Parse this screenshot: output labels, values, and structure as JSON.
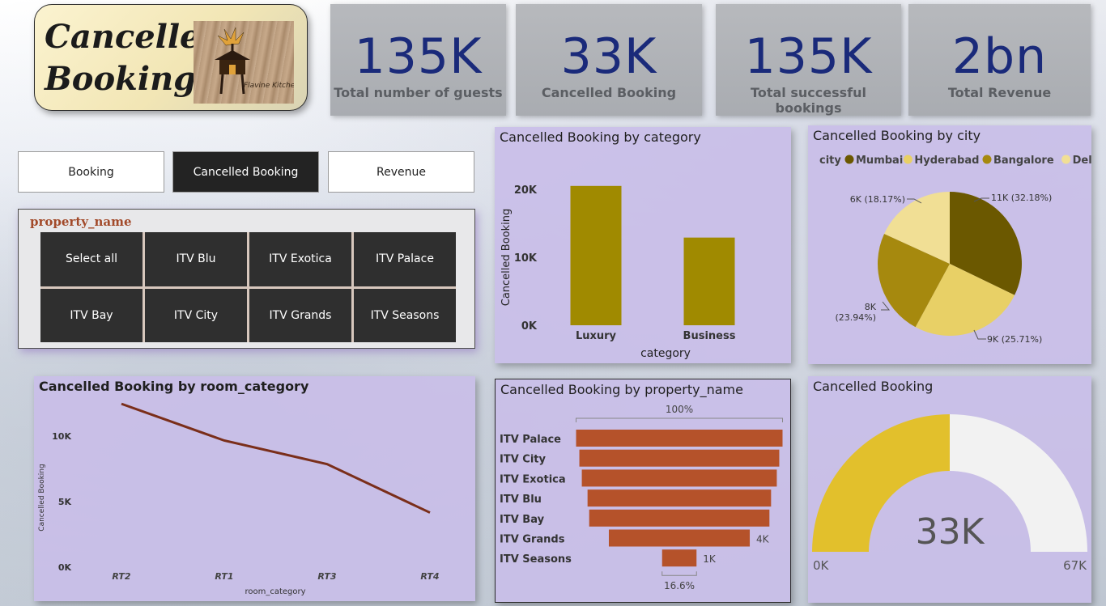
{
  "header": {
    "title_line1": "Cancelled",
    "title_line2": "Booking",
    "logo_text": "Flavine Kitchen"
  },
  "kpis": [
    {
      "value": "135K",
      "label": "Total number of guests"
    },
    {
      "value": "33K",
      "label": "Cancelled Booking"
    },
    {
      "value": "135K",
      "label": "Total successful bookings"
    },
    {
      "value": "2bn",
      "label": "Total Revenue"
    }
  ],
  "nav": {
    "booking": "Booking",
    "cancelled": "Cancelled Booking",
    "revenue": "Revenue"
  },
  "slicer": {
    "title": "property_name",
    "items": [
      "Select all",
      "ITV Blu",
      "ITV Exotica",
      "ITV Palace",
      "ITV Bay",
      "ITV City",
      "ITV Grands",
      "ITV Seasons"
    ]
  },
  "colors": {
    "kpi_value": "#1a2a7a",
    "bar_category": "#a08a00",
    "line": "#7a2e1a",
    "funnel": "#b5522a",
    "gauge_fill": "#e2c02c",
    "gauge_rest": "#f2f2f2",
    "panel_bg": "#c9bee8"
  },
  "chart_data": [
    {
      "type": "bar",
      "title": "Cancelled Booking by category",
      "xlabel": "category",
      "ylabel": "Cancelled Booking",
      "categories": [
        "Luxury",
        "Business"
      ],
      "values": [
        20500,
        12900
      ],
      "yticks": [
        "0K",
        "10K",
        "20K"
      ],
      "ylim": [
        0,
        20000
      ],
      "grid": false
    },
    {
      "type": "pie",
      "title": "Cancelled Booking by city",
      "legend_title": "city",
      "legend_position": "top",
      "slices": [
        {
          "name": "Mumbai",
          "value": 32.18,
          "label": "11K (32.18%)",
          "color": "#6b5800"
        },
        {
          "name": "Hyderabad",
          "value": 25.71,
          "label": "9K (25.71%)",
          "color": "#e8d066"
        },
        {
          "name": "Bangalore",
          "value": 23.94,
          "label_line1": "8K",
          "label_line2": "(23.94%)",
          "color": "#a6890e"
        },
        {
          "name": "Delhi",
          "value": 18.17,
          "label": "6K (18.17%)",
          "color": "#f1df95"
        }
      ]
    },
    {
      "type": "line",
      "title": "Cancelled Booking by room_category",
      "xlabel": "room_category",
      "ylabel": "Cancelled Booking",
      "categories": [
        "RT2",
        "RT1",
        "RT3",
        "RT4"
      ],
      "values": [
        12400,
        9600,
        7800,
        4100
      ],
      "yticks": [
        "0K",
        "5K",
        "10K"
      ],
      "ylim": [
        0,
        12000
      ]
    },
    {
      "type": "funnel",
      "title": "Cancelled Booking by property_name",
      "top_label": "100%",
      "bottom_label": "16.6%",
      "categories": [
        "ITV Palace",
        "ITV City",
        "ITV Exotica",
        "ITV Blu",
        "ITV Bay",
        "ITV Grands",
        "ITV Seasons"
      ],
      "values": [
        6300,
        6100,
        5950,
        5600,
        5500,
        4300,
        1050
      ],
      "data_labels": [
        "",
        "",
        "",
        "",
        "",
        "4K",
        "1K"
      ]
    },
    {
      "type": "gauge",
      "title": "Cancelled Booking",
      "value": 33400,
      "value_label": "33K",
      "min_label": "0K",
      "max_label": "67K",
      "min": 0,
      "max": 66800
    }
  ]
}
